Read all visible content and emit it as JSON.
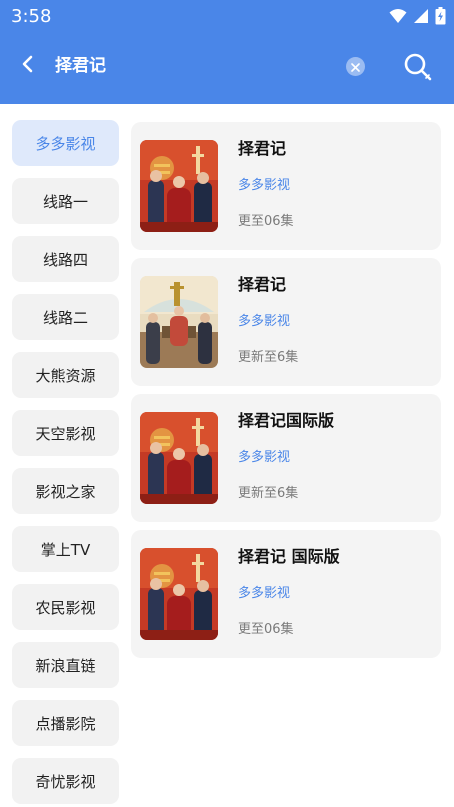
{
  "status_bar": {
    "time": "3:58"
  },
  "toolbar": {
    "query": "择君记",
    "back_icon": "back-arrow-icon",
    "clear_icon": "clear-icon",
    "search_icon": "search-icon"
  },
  "sources": [
    {
      "label": "多多影视",
      "active": true
    },
    {
      "label": "线路一",
      "active": false
    },
    {
      "label": "线路四",
      "active": false
    },
    {
      "label": "线路二",
      "active": false
    },
    {
      "label": "大熊资源",
      "active": false
    },
    {
      "label": "天空影视",
      "active": false
    },
    {
      "label": "影视之家",
      "active": false
    },
    {
      "label": "掌上TV",
      "active": false
    },
    {
      "label": "农民影视",
      "active": false
    },
    {
      "label": "新浪直链",
      "active": false
    },
    {
      "label": "点播影院",
      "active": false
    },
    {
      "label": "奇忧影视",
      "active": false
    }
  ],
  "results": [
    {
      "title": "择君记",
      "source": "多多影视",
      "episodes": "更至06集",
      "poster": "red"
    },
    {
      "title": "择君记",
      "source": "多多影视",
      "episodes": "更新至6集",
      "poster": "beige"
    },
    {
      "title": "择君记国际版",
      "source": "多多影视",
      "episodes": "更新至6集",
      "poster": "red"
    },
    {
      "title": "择君记 国际版",
      "source": "多多影视",
      "episodes": "更至06集",
      "poster": "red"
    }
  ],
  "colors": {
    "accent": "#4a86e8",
    "active_bg": "#dfe9fb",
    "item_bg": "#f2f2f2",
    "card_bg": "#f4f4f4"
  }
}
